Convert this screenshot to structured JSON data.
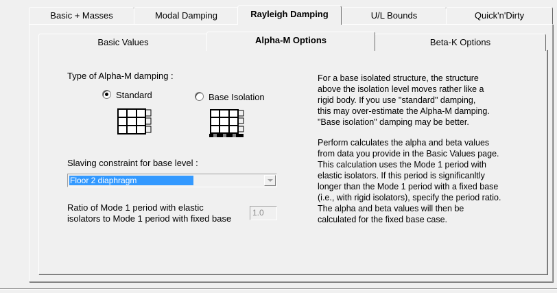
{
  "outer_tabs": [
    {
      "label": "Basic + Masses",
      "active": false
    },
    {
      "label": "Modal  Damping",
      "active": false
    },
    {
      "label": "Rayleigh Damping",
      "active": true
    },
    {
      "label": "U/L Bounds",
      "active": false
    },
    {
      "label": "Quick'n'Dirty",
      "active": false
    }
  ],
  "inner_tabs": [
    {
      "label": "Basic Values",
      "active": false
    },
    {
      "label": "Alpha-M Options",
      "active": true
    },
    {
      "label": "Beta-K Options",
      "active": false
    }
  ],
  "damping_type": {
    "label": "Type of Alpha-M damping :",
    "options": [
      {
        "label": "Standard",
        "selected": true,
        "icon": "building-frame-icon"
      },
      {
        "label": "Base Isolation",
        "selected": false,
        "icon": "base-isolated-building-icon"
      }
    ]
  },
  "slaving": {
    "label": "Slaving constraint for base level :",
    "value": "Floor 2 diaphragm"
  },
  "ratio": {
    "label_line1": "Ratio of Mode 1 period with elastic",
    "label_line2": "isolators to Mode 1 period with fixed base",
    "value": "1.0"
  },
  "help_text": {
    "p1": [
      "For a base isolated structure, the structure",
      "above the isolation level moves rather like a",
      "rigid body. If you use \"standard\" damping,",
      "this may over-estimate the Alpha-M damping.",
      "\"Base isolation\" damping may be better."
    ],
    "p2": [
      "Perform calculates the alpha and beta values",
      "from data you provide in the Basic Values page.",
      "This calculation uses the Mode 1 period with",
      "elastic isolators. If this period is significanltly",
      "longer than the Mode 1 period with a fixed base",
      "(i.e., with rigid isolators), specify the period ratio.",
      "The alpha and beta values will then be",
      "calculated for the fixed base case."
    ]
  },
  "colors": {
    "selection": "#3399ff",
    "panel": "#f0f0f0",
    "disabled_text": "#8a8a8a"
  }
}
